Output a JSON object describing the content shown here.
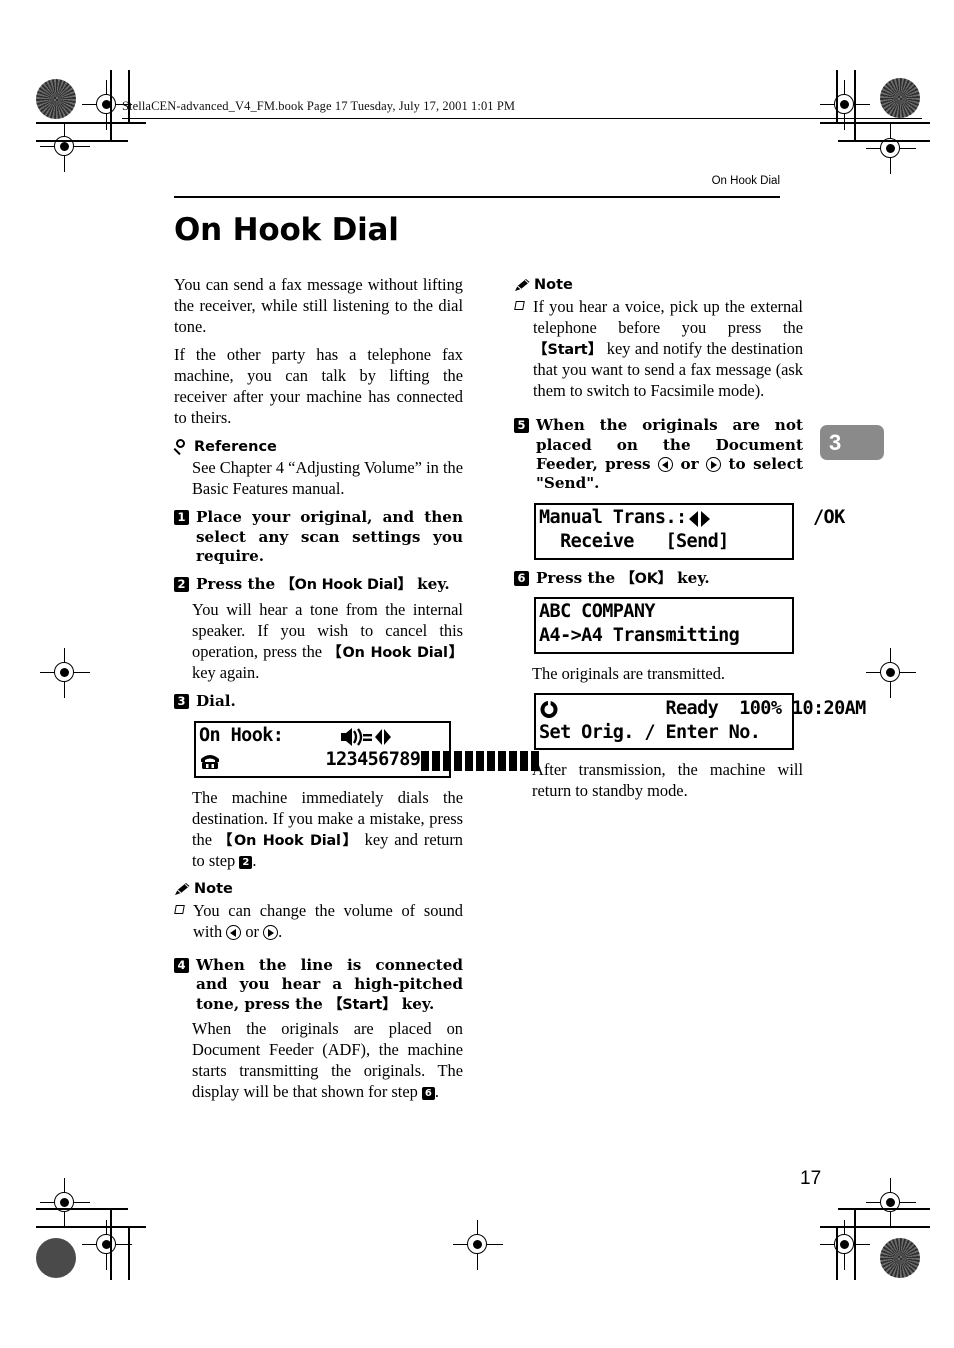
{
  "print_marks": {
    "file_line": "StellaCEN-advanced_V4_FM.book  Page 17  Tuesday, July 17, 2001  1:01 PM"
  },
  "header": {
    "running_head": "On Hook Dial"
  },
  "chapter_tab": {
    "number": "3",
    "color": "#8a8a8a"
  },
  "title": "On Hook Dial",
  "page_number": "17",
  "left_column": {
    "intro_paragraph_1": "You can send a fax message without lifting the receiver, while still listening to the dial tone.",
    "intro_paragraph_2": "If the other party has a telephone fax machine, you can talk by lifting the receiver after your machine has connected to theirs.",
    "reference": {
      "icon": "magnifier-icon",
      "label": "Reference",
      "text": "See Chapter 4 “Adjusting Volume” in the Basic Features manual."
    },
    "steps": [
      {
        "number": "1",
        "heading": "Place your original, and then select any scan settings you require."
      },
      {
        "number": "2",
        "heading_parts": {
          "before": "Press the ",
          "key": "【On Hook Dial】",
          "after": " key."
        },
        "body_parts": {
          "p1": "You will hear a tone from the internal speaker. If you wish to cancel this operation, press the ",
          "key": "【On Hook Dial】",
          "p2": " key again."
        }
      },
      {
        "number": "3",
        "heading": "Dial."
      }
    ],
    "lcd_on_hook": {
      "line1_left": "On Hook:",
      "line1_right_icon": "speaker-volume-icon",
      "line2_icon": "telephone-handset-icon",
      "line2_text": "123456789",
      "volume_bars": 11
    },
    "after_lcd_parts": {
      "p1": "The machine immediately dials the destination. If you make a mistake, press the ",
      "key": "【On Hook Dial】",
      "p2": " key and return to step ",
      "step_ref": "2",
      "p3": "."
    },
    "note": {
      "icon": "pencil-icon",
      "label": "Note",
      "items_parts": {
        "p1": "You can change the volume of sound with ",
        "left_key": "left-arrow-key",
        "p2": " or ",
        "right_key": "right-arrow-key",
        "p3": "."
      }
    },
    "step4": {
      "number": "4",
      "heading_parts": {
        "before": "When the line is connected and you hear a high-pitched tone, press the ",
        "key": "【Start】",
        "after": " key."
      },
      "body_parts": {
        "p1": "When the originals are placed on Document Feeder (ADF), the machine starts transmitting the originals. The display will be that shown for step ",
        "step_ref": "6",
        "p2": "."
      }
    }
  },
  "right_column": {
    "note": {
      "icon": "pencil-icon",
      "label": "Note",
      "item_parts": {
        "p1": "If you hear a voice, pick up the external telephone before you press the ",
        "key": "【Start】",
        "p2": " key and notify the destination that you want to send a fax message (ask them to switch to Facsimile mode)."
      }
    },
    "step5": {
      "number": "5",
      "heading_parts": {
        "p1": "When the originals are not placed on the Document Feeder, press ",
        "left_key": "left-arrow-key",
        "p2": " or ",
        "right_key": "right-arrow-key",
        "p3": " to select \"Send\"."
      }
    },
    "lcd_manual_trans": {
      "line1_left": "Manual Trans.:",
      "line1_right": "/OK",
      "line1_right_icon": "left-right-arrows-icon",
      "line2": "  Receive   [Send]"
    },
    "step6": {
      "number": "6",
      "heading_parts": {
        "before": "Press the ",
        "key": "【OK】",
        "after": " key."
      }
    },
    "lcd_transmitting": {
      "line1": "ABC COMPANY",
      "line2": "A4->A4 Transmitting"
    },
    "after_transmit_text": "The originals are transmitted.",
    "lcd_ready": {
      "line1_icon": "clock-icon",
      "line1": "Ready  100% 10:20AM",
      "line2": "Set Orig. / Enter No."
    },
    "closing_text": "After transmission, the machine will return to standby mode."
  }
}
